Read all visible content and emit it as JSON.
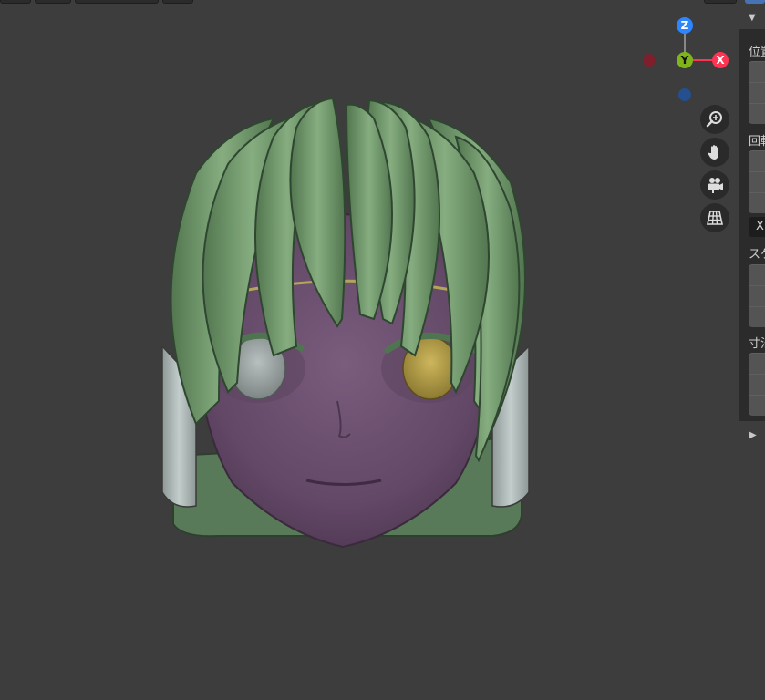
{
  "gizmo": {
    "z_label": "Z",
    "y_label": "Y",
    "x_label": "X",
    "colors": {
      "x": "#ff3352",
      "y": "#7fb51b",
      "z": "#2e86ff"
    }
  },
  "nav_tools": [
    {
      "name": "zoom-icon"
    },
    {
      "name": "pan-hand-icon"
    },
    {
      "name": "camera-icon"
    },
    {
      "name": "perspective-grid-icon"
    }
  ],
  "npanel": {
    "location_label": "位置",
    "rotation_label": "回転",
    "rotation_mode": "X",
    "scale_label": "スケ",
    "dimensions_label": "寸法"
  },
  "model": {
    "description_colors": {
      "hair": "#6f9a6a",
      "skin": "#6e5270",
      "eye_left": "#9ba2a2",
      "eye_right": "#b59f4a",
      "back": "#a9b5b3"
    }
  }
}
